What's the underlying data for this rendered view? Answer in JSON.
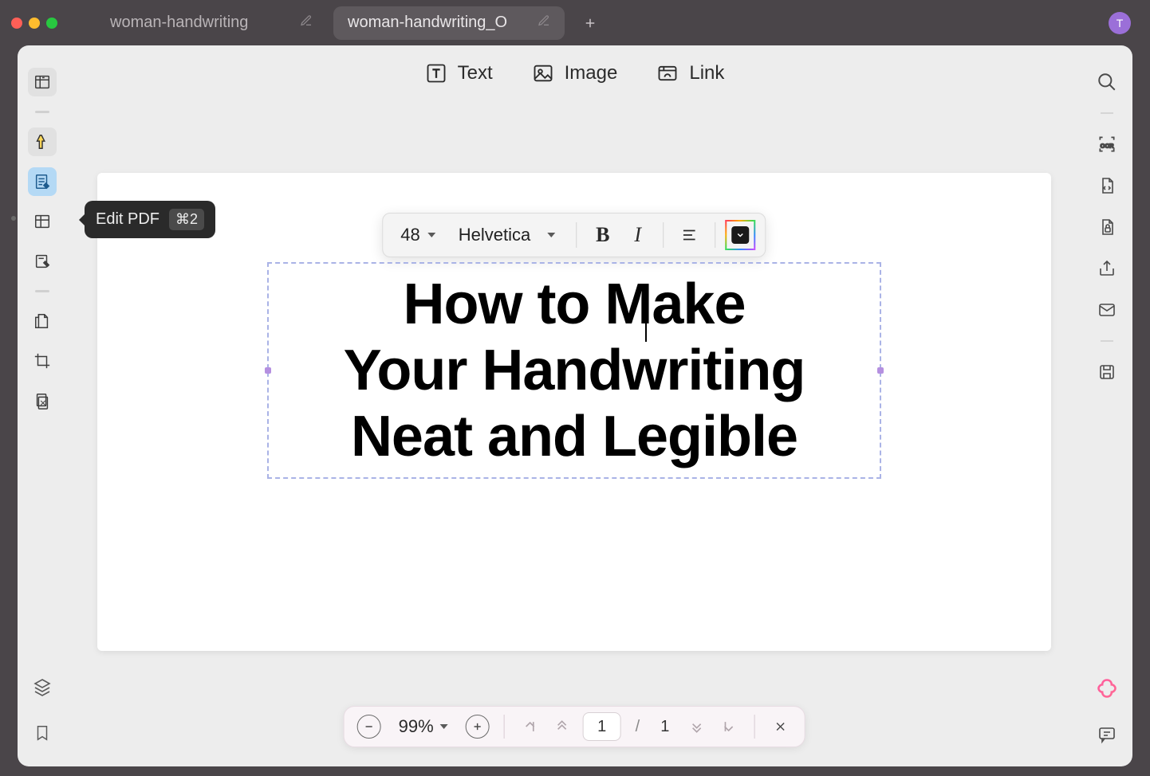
{
  "tabs": [
    {
      "label": "woman-handwriting",
      "active": false
    },
    {
      "label": "woman-handwriting_O",
      "active": true
    }
  ],
  "avatar_letter": "T",
  "tooltip": {
    "label": "Edit PDF",
    "shortcut": "⌘2"
  },
  "top_toolbar": {
    "text_label": "Text",
    "image_label": "Image",
    "link_label": "Link"
  },
  "format_bar": {
    "font_size": "48",
    "font_family": "Helvetica"
  },
  "document": {
    "line1": "How to Make",
    "line2": "Your Handwriting",
    "line3": "Neat and Legible"
  },
  "bottom_bar": {
    "zoom": "99%",
    "current_page": "1",
    "total_pages": "1",
    "separator": "/"
  }
}
